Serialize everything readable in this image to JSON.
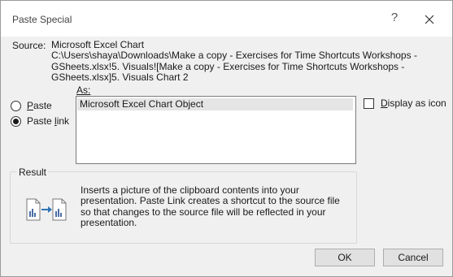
{
  "dialog": {
    "title": "Paste Special",
    "help_label": "?"
  },
  "source": {
    "label": "Source:",
    "lines": [
      "Microsoft Excel Chart",
      "C:\\Users\\shaya\\Downloads\\Make a copy - Exercises for Time Shortcuts Workshops -",
      "GSheets.xlsx!5. Visuals![Make a copy - Exercises for Time Shortcuts Workshops -",
      "GSheets.xlsx]5. Visuals Chart 2"
    ]
  },
  "as": {
    "label": "As:",
    "items": [
      "Microsoft Excel Chart Object"
    ],
    "selected": "Microsoft Excel Chart Object"
  },
  "options": {
    "paste_label": "Paste",
    "paste_link_label": "Paste link",
    "selected": "paste_link"
  },
  "display_as_icon": {
    "label": "Display as icon",
    "checked": false
  },
  "result": {
    "label": "Result",
    "text": "Inserts a picture of the clipboard contents into your presentation. Paste Link creates a shortcut to the source file so that changes to the source file will be reflected in your presentation.",
    "icon": "paste-link-result-icon"
  },
  "buttons": {
    "ok": "OK",
    "cancel": "Cancel"
  }
}
